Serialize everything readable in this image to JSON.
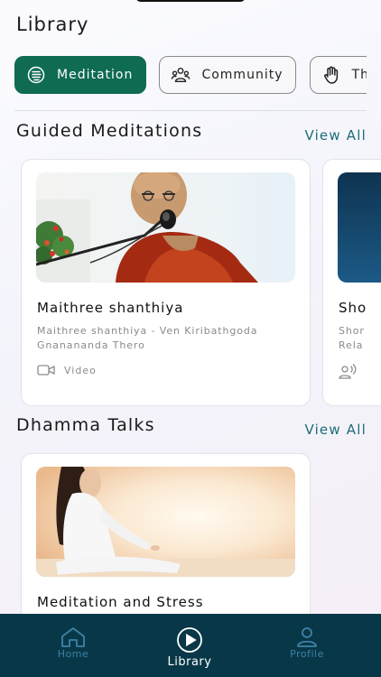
{
  "page": {
    "title": "Library"
  },
  "chips": [
    {
      "label": "Meditation",
      "icon": "meditation-icon",
      "active": true
    },
    {
      "label": "Community",
      "icon": "community-icon",
      "active": false
    },
    {
      "label": "Th",
      "icon": "hand-icon",
      "active": false
    }
  ],
  "guided": {
    "title": "Guided Meditations",
    "view_all": "View All",
    "cards": [
      {
        "title": "Maithree shanthiya",
        "subtitle": "Maithree shanthiya - Ven Kiribathgoda Gnanananda Thero",
        "type": "Video",
        "icon": "video-icon"
      },
      {
        "title": "Sho",
        "subtitle": "Shor Rela",
        "icon": "audio-icon"
      }
    ]
  },
  "dhamma": {
    "title": "Dhamma Talks",
    "view_all": "View All",
    "cards": [
      {
        "title": "Meditation and Stress"
      }
    ]
  },
  "nav": {
    "items": [
      {
        "label": "Home",
        "icon": "home-icon",
        "active": false
      },
      {
        "label": "Library",
        "icon": "play-circle-icon",
        "active": true
      },
      {
        "label": "Profile",
        "icon": "profile-icon",
        "active": false
      }
    ]
  },
  "colors": {
    "accent": "#0f6b52",
    "link": "#1d6d78",
    "nav_bg": "#083848",
    "nav_inactive": "#3f82a8"
  }
}
